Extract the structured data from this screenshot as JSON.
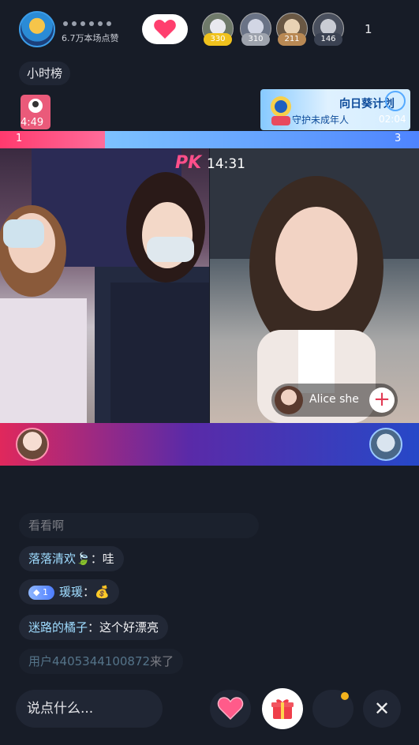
{
  "header": {
    "host_stat": "6.7万本场点赞",
    "viewers": [
      {
        "count": "330",
        "color": "#f0c21d"
      },
      {
        "count": "310",
        "color": "#cfcfd6"
      },
      {
        "count": "211",
        "color": "#d4a36a"
      },
      {
        "count": "146",
        "color": "#3b4252"
      }
    ],
    "more_label": "1"
  },
  "hour_rank": "小时榜",
  "mini_timer": "4:49",
  "banner": {
    "title": "向日葵计划",
    "subtitle": "守护未成年人",
    "timer": "02:04"
  },
  "pk": {
    "left_score": "1",
    "right_score": "3",
    "left_fraction": 0.25,
    "label": "PK",
    "timer": "14:31",
    "opponent_name": "Alice she",
    "add_symbol": "+"
  },
  "chat": {
    "messages": [
      {
        "name": "",
        "text": "看看啊",
        "faded": true
      },
      {
        "name": "落落清欢🍃",
        "text": "：哇",
        "faded": false
      },
      {
        "badge": "1",
        "name": "瑗瑗",
        "text": "：💰",
        "faded": false
      },
      {
        "name": "迷路的橘子",
        "text": "：这个好漂亮",
        "faded": false
      },
      {
        "name": "用户4405344100872",
        "text": "来了",
        "faded": true
      }
    ]
  },
  "bottom": {
    "input_placeholder": "说点什么...",
    "close_symbol": "✕"
  },
  "colors": {
    "accent_pink": "#ff3a6e",
    "accent_blue": "#4e84ff",
    "notif_dot": "#f3b21c"
  }
}
